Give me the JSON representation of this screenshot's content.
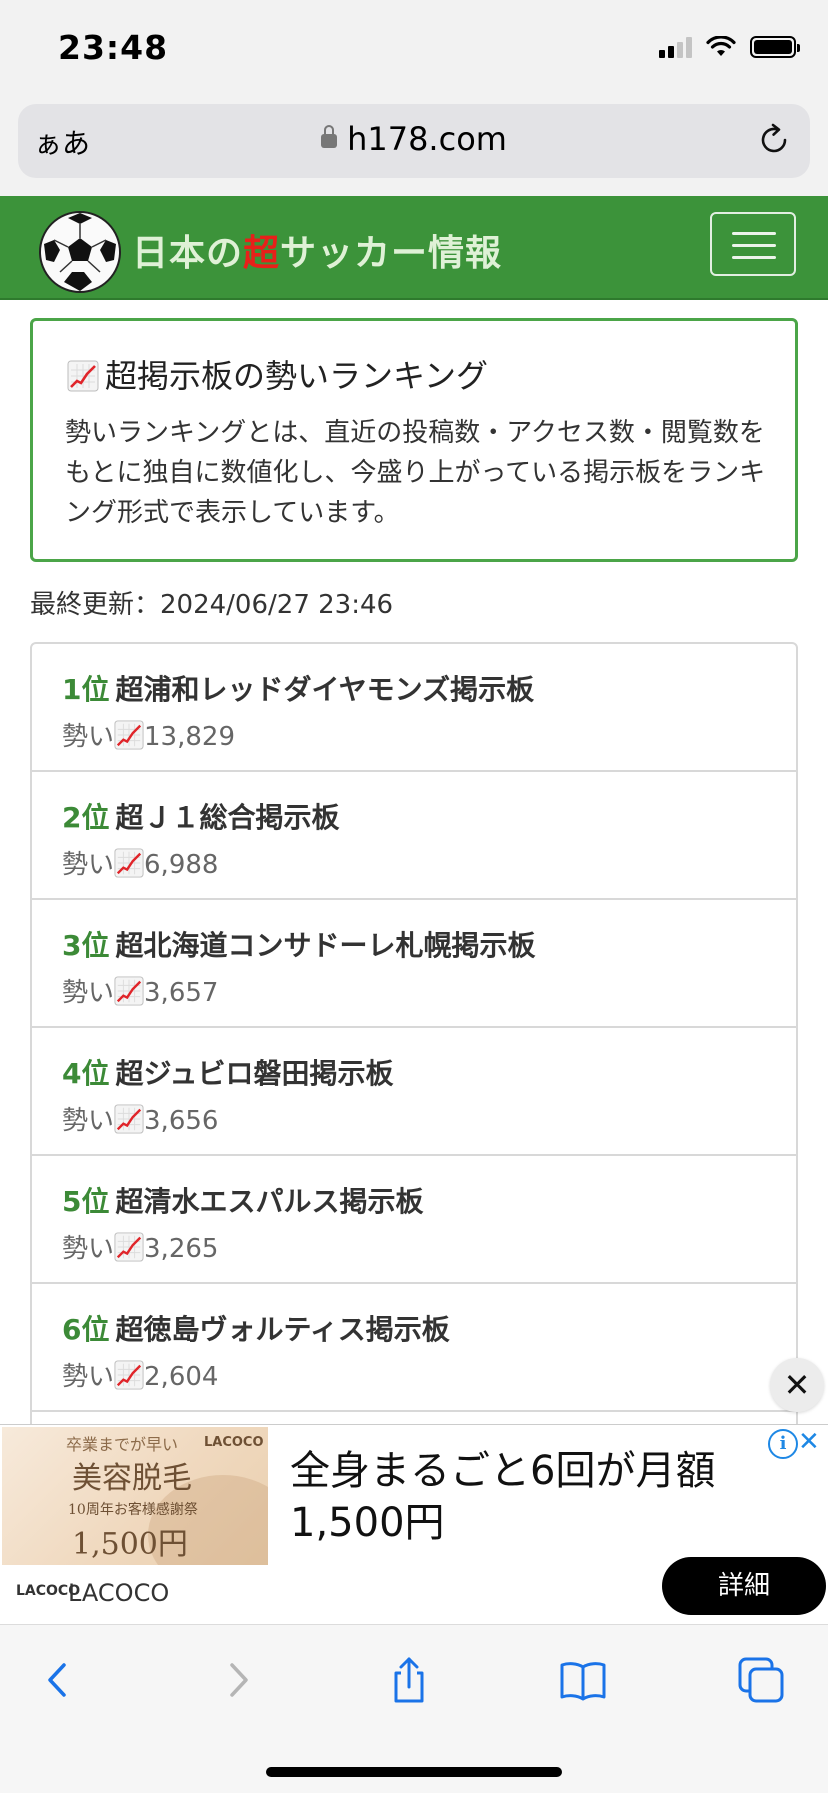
{
  "status_bar": {
    "time": "23:48"
  },
  "url_bar": {
    "aa_label": "ぁあ",
    "domain": "h178.com"
  },
  "header": {
    "title_part1": "日本の",
    "title_highlight": "超",
    "title_part2": "サッカー情報"
  },
  "info_box": {
    "title": "超掲示板の勢いランキング",
    "description": "勢いランキングとは、直近の投稿数・アクセス数・閲覧数をもとに独自に数値化し、今盛り上がっている掲示板をランキング形式で表示しています。"
  },
  "last_updated": "最終更新：2024/06/27 23:46",
  "ranking": {
    "momentum_label": "勢い",
    "items": [
      {
        "rank": "1位",
        "name": "超浦和レッドダイヤモンズ掲示板",
        "score": "13,829"
      },
      {
        "rank": "2位",
        "name": "超Ｊ１総合掲示板",
        "score": "6,988"
      },
      {
        "rank": "3位",
        "name": "超北海道コンサドーレ札幌掲示板",
        "score": "3,657"
      },
      {
        "rank": "4位",
        "name": "超ジュビロ磐田掲示板",
        "score": "3,656"
      },
      {
        "rank": "5位",
        "name": "超清水エスパルス掲示板",
        "score": "3,265"
      },
      {
        "rank": "6位",
        "name": "超徳島ヴォルティス掲示板",
        "score": "2,604"
      }
    ]
  },
  "ad": {
    "image_text_1": "卒業までが早い",
    "image_text_2": "美容脱毛",
    "image_text_3": "10周年お客様感謝祭",
    "image_text_4": "1,500円",
    "image_logo": "LACOCO",
    "headline": "全身まるごと6回が月額1,500円",
    "brand_logo": "LACOCO",
    "brand": "LACOCO",
    "detail_button": "詳細",
    "info_icon": "i",
    "close_icon": "✕"
  },
  "close_button": "✕",
  "colors": {
    "header_green": "#3c933a",
    "border_green": "#4ba548",
    "rank_green": "#3c8a37",
    "title_red": "#e8201a",
    "ad_blue": "#1e88e5"
  },
  "icons": [
    "lock-icon",
    "reload-icon",
    "soccer-ball-icon",
    "hamburger-menu-icon",
    "chart-increasing-icon",
    "close-icon",
    "back-icon",
    "forward-icon",
    "share-icon",
    "bookmarks-icon",
    "tabs-icon"
  ]
}
